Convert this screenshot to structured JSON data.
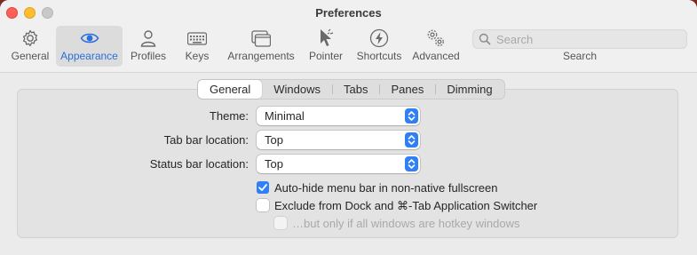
{
  "window": {
    "title": "Preferences"
  },
  "toolbar": {
    "items": [
      {
        "id": "general",
        "label": "General",
        "icon": "gear-icon"
      },
      {
        "id": "appearance",
        "label": "Appearance",
        "icon": "eye-icon",
        "selected": true
      },
      {
        "id": "profiles",
        "label": "Profiles",
        "icon": "person-icon"
      },
      {
        "id": "keys",
        "label": "Keys",
        "icon": "keyboard-icon"
      },
      {
        "id": "arrangements",
        "label": "Arrangements",
        "icon": "windows-icon"
      },
      {
        "id": "pointer",
        "label": "Pointer",
        "icon": "pointer-icon"
      },
      {
        "id": "shortcuts",
        "label": "Shortcuts",
        "icon": "bolt-icon"
      },
      {
        "id": "advanced",
        "label": "Advanced",
        "icon": "gears-icon"
      }
    ],
    "search": {
      "placeholder": "Search",
      "label": "Search"
    }
  },
  "tabs": {
    "items": [
      "General",
      "Windows",
      "Tabs",
      "Panes",
      "Dimming"
    ],
    "selected": "General"
  },
  "form": {
    "theme": {
      "label": "Theme:",
      "value": "Minimal"
    },
    "tab_bar_location": {
      "label": "Tab bar location:",
      "value": "Top"
    },
    "status_bar_location": {
      "label": "Status bar location:",
      "value": "Top"
    },
    "auto_hide": {
      "label": "Auto-hide menu bar in non-native fullscreen",
      "checked": true
    },
    "exclude_dock": {
      "label": "Exclude from Dock and ⌘-Tab Application Switcher",
      "checked": false
    },
    "only_hotkey": {
      "label": "…but only if all windows are hotkey windows",
      "checked": false,
      "disabled": true
    }
  },
  "colors": {
    "accent": "#2f7ff6",
    "selected_tab_text": "#2a6fdb"
  }
}
